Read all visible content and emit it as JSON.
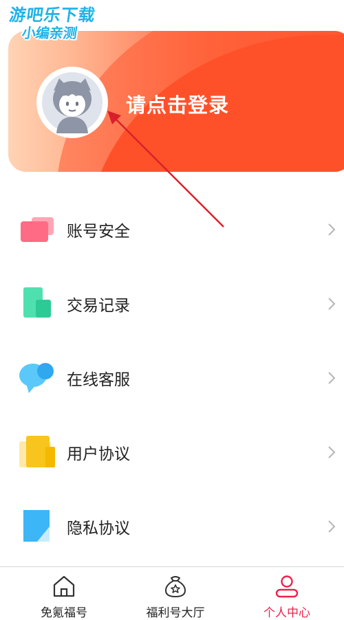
{
  "watermark": {
    "line1": "游吧乐下载",
    "line2": "小编亲测"
  },
  "profile": {
    "login_prompt": "请点击登录",
    "avatar_icon": "avatar-icon"
  },
  "menu": {
    "items": [
      {
        "label": "账号安全",
        "icon": "account-security-icon"
      },
      {
        "label": "交易记录",
        "icon": "transaction-record-icon"
      },
      {
        "label": "在线客服",
        "icon": "online-service-icon"
      },
      {
        "label": "用户协议",
        "icon": "user-agreement-icon"
      },
      {
        "label": "隐私协议",
        "icon": "privacy-agreement-icon"
      }
    ]
  },
  "bottom_nav": {
    "items": [
      {
        "label": "免氪福号",
        "icon": "home-icon",
        "active": false
      },
      {
        "label": "福利号大厅",
        "icon": "welfare-bag-icon",
        "active": false
      },
      {
        "label": "个人中心",
        "icon": "user-icon",
        "active": true
      }
    ]
  },
  "colors": {
    "accent": "#f0204b",
    "header_orange": "#ff5129",
    "text": "#222222"
  }
}
